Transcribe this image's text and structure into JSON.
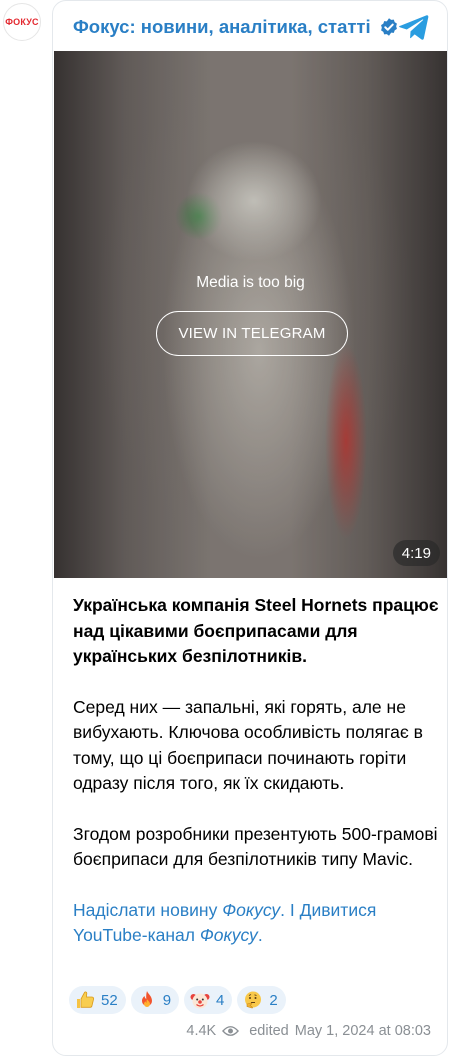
{
  "channel": {
    "avatar_text": "ФОКУС",
    "title": "Фокус: новини, аналітика, статті",
    "verified": true,
    "accent_color": "#2a7fc5"
  },
  "media": {
    "message": "Media is too big",
    "button_label": "VIEW IN TELEGRAM",
    "duration": "4:19"
  },
  "post": {
    "paragraph1": "Українська компанія Steel Hornets працює над цікавими боєприпасами для українських безпілотників.",
    "paragraph2": "Серед них — запальні, які горять, але не вибухають. Ключова особливість полягає в тому, що ці боєприпаси починають горіти одразу після того, як їх скидають.",
    "paragraph3": "Згодом розробники презентують 500-грамові боєприпаси для безпілотників типу Mavic.",
    "link1_text": "Надіслати новину ",
    "link1_italic": "Фокусу",
    "separator": ". І ",
    "link2_text": "Дивитися YouTube-канал ",
    "link2_italic": "Фокусу",
    "end": "."
  },
  "reactions": [
    {
      "emoji": "thumbs-up-icon",
      "count": "52"
    },
    {
      "emoji": "fire-icon",
      "count": "9"
    },
    {
      "emoji": "clown-face-icon",
      "count": "4"
    },
    {
      "emoji": "thinking-face-icon",
      "count": "2"
    }
  ],
  "meta": {
    "views": "4.4K",
    "edited": "edited",
    "timestamp": "May 1, 2024 at 08:03"
  }
}
